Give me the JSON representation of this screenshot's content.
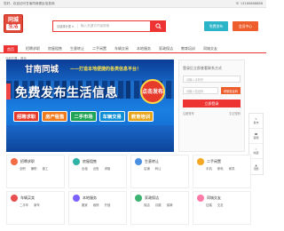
{
  "topbar": {
    "greeting": "您好，欢迎访问甘南同城便民信息网",
    "phone": "13180888888"
  },
  "logo": {
    "line1": "同城",
    "line2": "生活"
  },
  "search": {
    "category": "请选择分类",
    "placeholder": "输入关键字开始搜索"
  },
  "header_buttons": {
    "free_post": "免费发布",
    "manage": "会员中心"
  },
  "nav": {
    "items": [
      "首页",
      "招聘求职",
      "房屋租售",
      "生意转让",
      "二手闲置",
      "车辆交易",
      "本地服务",
      "家政保洁",
      "教育培训",
      "同城交友"
    ]
  },
  "breadcrumb": "当前位置：首页",
  "banner": {
    "title": "甘南同城",
    "slogan": "——打造本地便捷的各类信息平台！",
    "headline": "免费发布生活信息",
    "circle": "点击发布",
    "chips": [
      "招聘求职",
      "房产租售",
      "二手市场",
      "车辆交易",
      "教育培训"
    ]
  },
  "login": {
    "title": "登录后立即查看联系方式",
    "phone_placeholder": "请输入手机号",
    "code_placeholder": "请输入验证码",
    "code_btn": "获取验证码",
    "submit": "立即登录",
    "link_register": "注册账号",
    "link_forgot": "忘记密码"
  },
  "sidebar": [
    "发布",
    "客服",
    "收藏",
    "顶部"
  ],
  "cards": [
    {
      "name": "招聘求职",
      "color": "#f46b45",
      "subs": [
        "全职",
        "兼职",
        "普工"
      ]
    },
    {
      "name": "房屋租售",
      "color": "#2eb3a5",
      "subs": [
        "出租",
        "出售",
        "求租"
      ]
    },
    {
      "name": "生意转让",
      "color": "#4a90e2",
      "subs": [
        "店铺",
        "转让"
      ]
    },
    {
      "name": "二手闲置",
      "color": "#f5a623",
      "subs": [
        "手机",
        "家电",
        "家具"
      ]
    },
    {
      "name": "车辆买卖",
      "color": "#e94e4e",
      "subs": [
        "二手车",
        "新车"
      ]
    },
    {
      "name": "本地服务",
      "color": "#7b61ff",
      "subs": [
        "搬家",
        "维修",
        "开锁"
      ]
    },
    {
      "name": "家政保洁",
      "color": "#3cb371",
      "subs": [
        "保洁",
        "月嫂",
        "保姆"
      ]
    },
    {
      "name": "同城交友",
      "color": "#ff7aa8",
      "subs": [
        "征婚",
        "交友"
      ]
    }
  ]
}
